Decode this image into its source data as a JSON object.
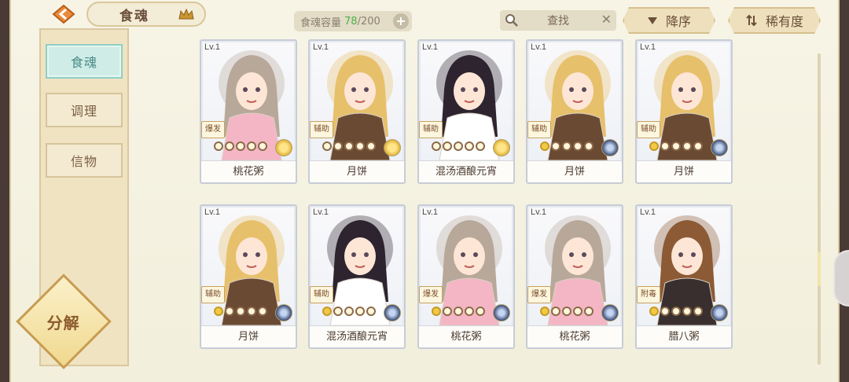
{
  "header": {
    "title": "食魂",
    "capacity_label": "食魂容量",
    "capacity_current": "78",
    "capacity_sep": "/",
    "capacity_max": "200",
    "search_placeholder": "查找",
    "sort_order": "降序",
    "sort_key": "稀有度"
  },
  "sidebar": {
    "items": [
      {
        "label": "食魂",
        "active": true
      },
      {
        "label": "调理",
        "active": false
      },
      {
        "label": "信物",
        "active": false
      }
    ],
    "decompose_label": "分解"
  },
  "cards": [
    {
      "level": "Lv.1",
      "name": "桃花粥",
      "role": "爆发",
      "stars_on": 0,
      "element": "gold",
      "hair": "#b8a89a",
      "robe": "#f4b6c4"
    },
    {
      "level": "Lv.1",
      "name": "月饼",
      "role": "辅助",
      "stars_on": 0,
      "element": "gold",
      "hair": "#e7c06b",
      "robe": "#6b4a33"
    },
    {
      "level": "Lv.1",
      "name": "混汤酒酿元宵",
      "role": "辅助",
      "stars_on": 0,
      "element": "gold",
      "hair": "#2d2430",
      "robe": "#ffffff"
    },
    {
      "level": "Lv.1",
      "name": "月饼",
      "role": "辅助",
      "stars_on": 1,
      "element": "blue",
      "hair": "#e7c06b",
      "robe": "#6b4a33"
    },
    {
      "level": "Lv.1",
      "name": "月饼",
      "role": "辅助",
      "stars_on": 1,
      "element": "blue",
      "hair": "#e7c06b",
      "robe": "#6b4a33"
    },
    {
      "level": "Lv.1",
      "name": "月饼",
      "role": "辅助",
      "stars_on": 1,
      "element": "blue",
      "hair": "#e7c06b",
      "robe": "#6b4a33"
    },
    {
      "level": "Lv.1",
      "name": "混汤酒酿元宵",
      "role": "辅助",
      "stars_on": 1,
      "element": "blue",
      "hair": "#2d2430",
      "robe": "#ffffff"
    },
    {
      "level": "Lv.1",
      "name": "桃花粥",
      "role": "爆发",
      "stars_on": 1,
      "element": "blue",
      "hair": "#b8a89a",
      "robe": "#f4b6c4"
    },
    {
      "level": "Lv.1",
      "name": "桃花粥",
      "role": "爆发",
      "stars_on": 1,
      "element": "blue",
      "hair": "#b8a89a",
      "robe": "#f4b6c4"
    },
    {
      "level": "Lv.1",
      "name": "腊八粥",
      "role": "附毒",
      "stars_on": 1,
      "element": "blue",
      "hair": "#8c5a34",
      "robe": "#3a2f2f"
    }
  ],
  "colors": {
    "accent_green": "#49b24a",
    "active_tab": "#cfece6",
    "frame": "#f2efdc"
  }
}
